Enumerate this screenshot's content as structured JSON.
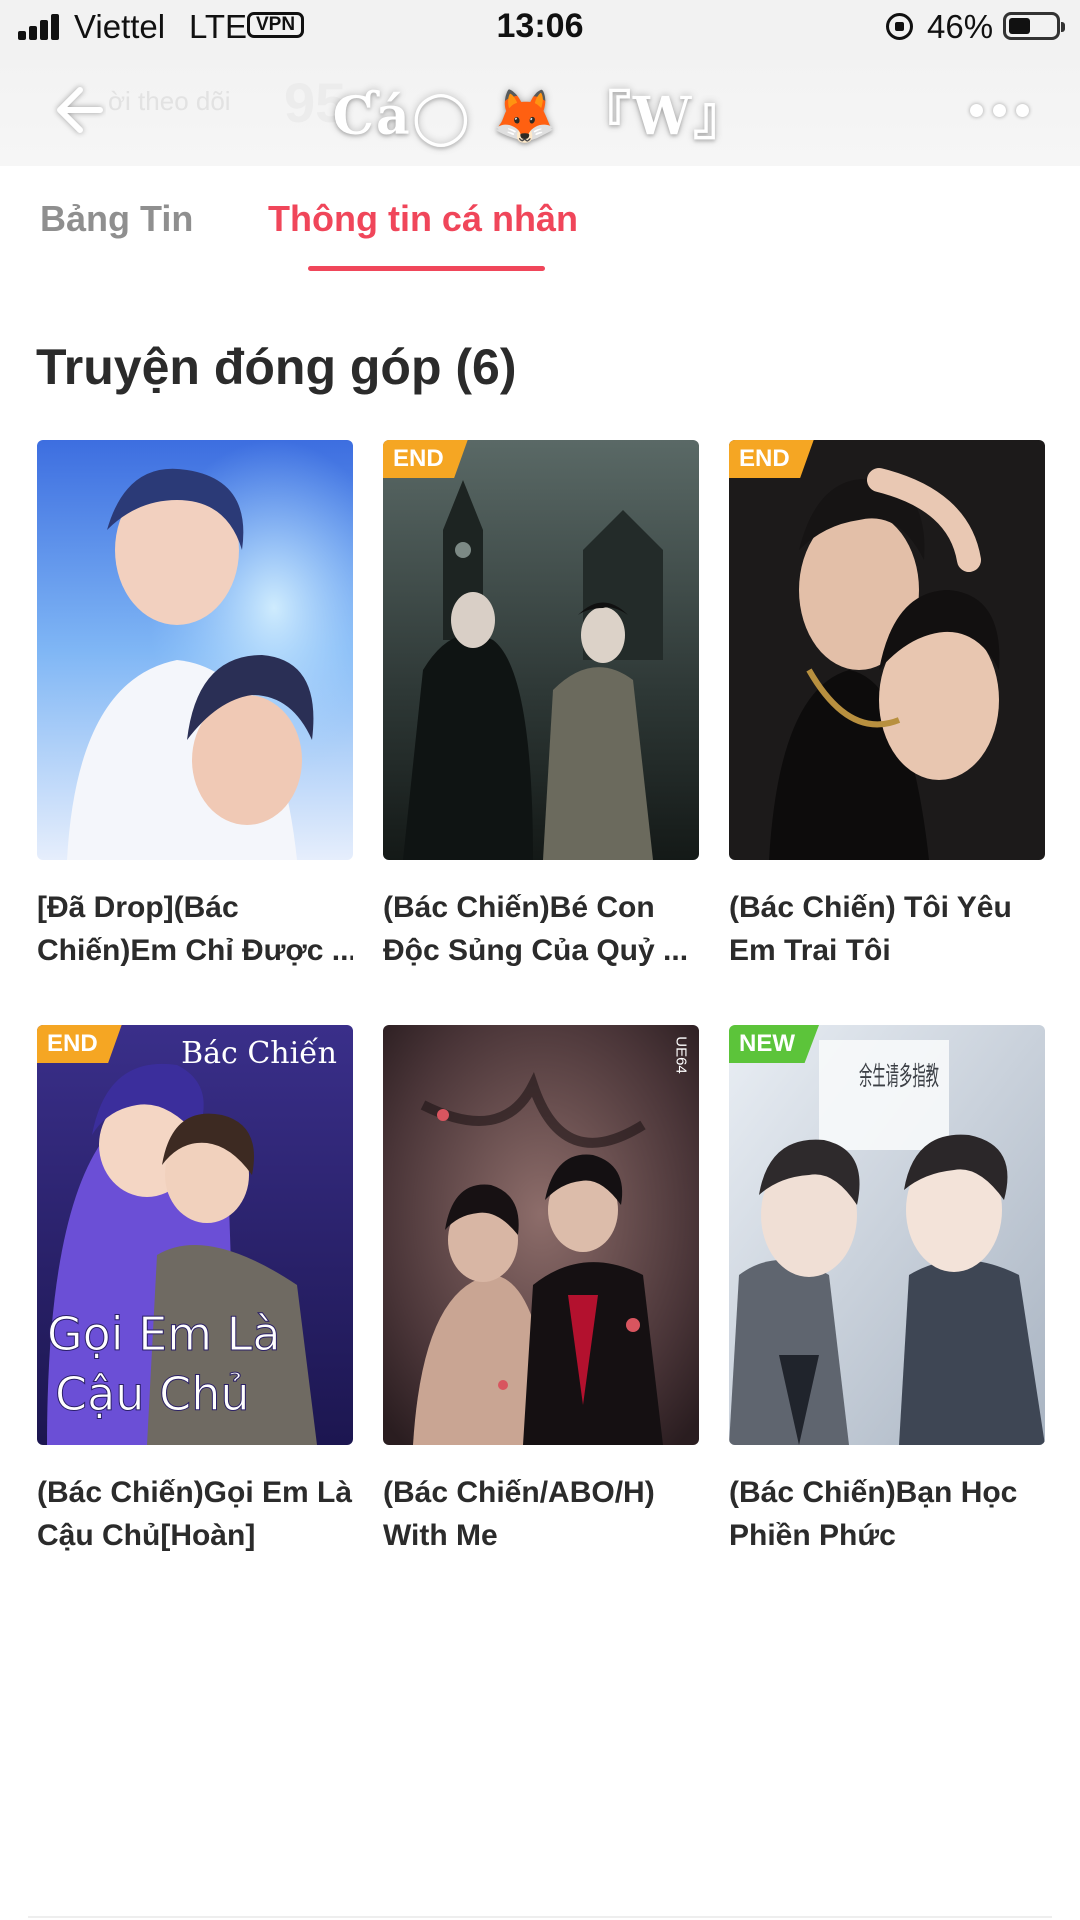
{
  "status_bar": {
    "carrier": "Viettel",
    "network": "LTE",
    "vpn": "VPN",
    "time": "13:06",
    "battery_percent": "46%",
    "battery_level": 0.46
  },
  "header": {
    "back_icon": "arrow-left-icon",
    "faded_label": "ời theo dõi",
    "faded_count": "95",
    "profile_name": "Ƈá◯ 🦊 『W』",
    "more_icon": "more-dots-icon"
  },
  "tabs": [
    {
      "label": "Bảng Tin",
      "active": false
    },
    {
      "label": "Thông tin cá nhân",
      "active": true
    }
  ],
  "colors": {
    "accent": "#f0465a",
    "badge_end": "#f5a623",
    "badge_new": "#5cc43a"
  },
  "section": {
    "title": "Truyện đóng góp (6)"
  },
  "stories": [
    {
      "title_line1": "[Đã Drop](Bác",
      "title_line2": "Chiến)Em Chỉ Được ...",
      "badge": ""
    },
    {
      "title_line1": "(Bác Chiến)Bé Con",
      "title_line2": "Độc Sủng Của Quỷ ...",
      "badge": "END"
    },
    {
      "title_line1": "(Bác Chiến) Tôi Yêu",
      "title_line2": "Em Trai Tôi",
      "badge": "END"
    },
    {
      "title_line1": "(Bác Chiến)Gọi Em Là",
      "title_line2": "Cậu Chủ[Hoàn]",
      "badge": "END",
      "cover_text_top": "Bác Chiến",
      "cover_text_line1": "Gọi Em Là",
      "cover_text_line2": "Cậu Chủ"
    },
    {
      "title_line1": "(Bác Chiến/ABO/H)",
      "title_line2": "With Me",
      "badge": "",
      "cover_text_side": "UE64"
    },
    {
      "title_line1": "(Bác Chiến)Bạn Học",
      "title_line2": "Phiền Phức",
      "badge": "NEW",
      "cover_text_top": "余生请多指教"
    }
  ]
}
